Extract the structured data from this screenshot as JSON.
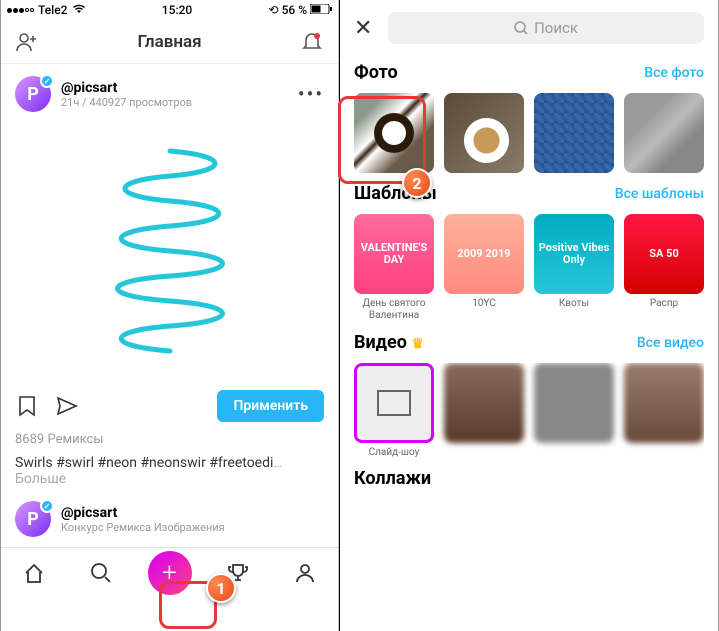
{
  "status": {
    "carrier": "Tele2",
    "time": "15:20",
    "battery": "56 %",
    "batt_icon": "▭"
  },
  "header": {
    "title": "Главная"
  },
  "post": {
    "username": "@picsart",
    "subtitle": "21ч / 440927 просмотров",
    "apply": "Применить",
    "remixes": "8689 Ремиксы",
    "caption": "Swirls #swirl #neon #neonswir #freetoedi",
    "more": "…Больше"
  },
  "post2": {
    "username": "@picsart",
    "subtitle": "Конкурс Ремикса Изображения"
  },
  "right": {
    "search_placeholder": "Поиск",
    "photos": {
      "title": "Фото",
      "link": "Все фото"
    },
    "templates": {
      "title": "Шаблоны",
      "link": "Все шаблоны",
      "items": [
        {
          "label": "День святого\nВалентина",
          "text": "VALENTINE'S DAY"
        },
        {
          "label": "10YC",
          "text": "2009 2019"
        },
        {
          "label": "Квоты",
          "text": "Positive Vibes Only"
        },
        {
          "label": "Распр",
          "text": "SA 50"
        }
      ]
    },
    "videos": {
      "title": "Видео",
      "link": "Все видео",
      "first": "Слайд-шоу"
    },
    "collages": {
      "title": "Коллажи"
    }
  },
  "callouts": {
    "one": "1",
    "two": "2"
  }
}
